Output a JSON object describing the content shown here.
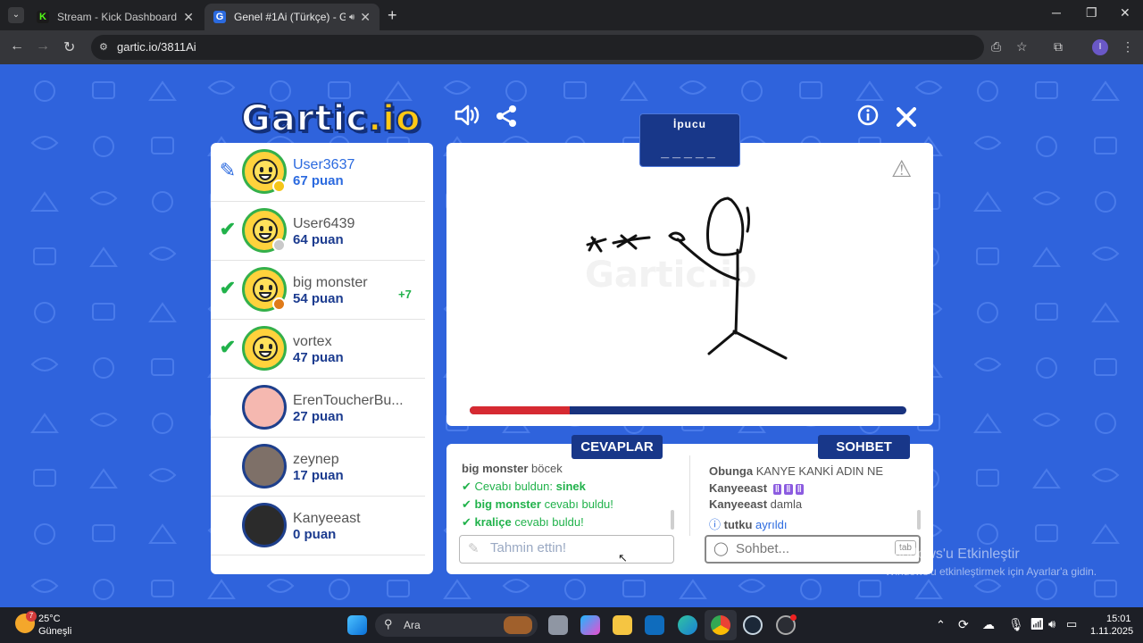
{
  "browser": {
    "tabs": [
      {
        "title": "Stream - Kick Dashboard",
        "icon": "kick-icon",
        "active": false
      },
      {
        "title": "Genel #1Ai (Türkçe) - Gartic",
        "icon": "gartic-icon",
        "active": true
      }
    ],
    "url": "gartic.io/3811Ai",
    "profile_initial": "I"
  },
  "game": {
    "logo_main": "Gartic",
    "logo_suffix": ".io",
    "hint_label": "İpucu",
    "hint_word": "_____",
    "timer_elapsed_fraction": 0.23,
    "players": [
      {
        "name": "User3637",
        "points": "67 puan",
        "status": "drawing",
        "badge_color": "#f5c518",
        "avatar": "smiley",
        "me": true,
        "bonus": ""
      },
      {
        "name": "User6439",
        "points": "64 puan",
        "status": "guessed",
        "badge_color": "#c9c9c9",
        "avatar": "smiley",
        "me": false,
        "bonus": ""
      },
      {
        "name": "big monster",
        "points": "54 puan",
        "status": "guessed",
        "badge_color": "#e07b1a",
        "avatar": "smiley",
        "me": false,
        "bonus": "+7"
      },
      {
        "name": "vortex",
        "points": "47 puan",
        "status": "guessed",
        "badge_color": "",
        "avatar": "smiley",
        "me": false,
        "bonus": ""
      },
      {
        "name": "ErenToucherBu...",
        "points": "27 puan",
        "status": "",
        "badge_color": "",
        "avatar": "tan",
        "me": false,
        "bonus": ""
      },
      {
        "name": "zeynep",
        "points": "17 puan",
        "status": "",
        "badge_color": "",
        "avatar": "photo",
        "me": false,
        "bonus": ""
      },
      {
        "name": "Kanyeeast",
        "points": "0 puan",
        "status": "",
        "badge_color": "",
        "avatar": "dark",
        "me": false,
        "bonus": ""
      }
    ],
    "answers_tab": "CEVAPLAR",
    "chat_tab": "SOHBET",
    "answers": {
      "line1_user": "big monster",
      "line1_text": "böcek",
      "line2_text": "Cevabı buldun: ",
      "line2_word": "sinek",
      "line3_user": "big monster",
      "line3_text": "cevabı buldu!",
      "line4_user": "kraliçe",
      "line4_text": "cevabı buldu!"
    },
    "chat": {
      "line1_user": "Obunga",
      "line1_text": "KANYE KANKİ ADIN NE",
      "line2_user": "Kanyeeast",
      "line2_emotes": [
        "Ⅱ",
        "Ⅱ",
        "Ⅱ"
      ],
      "line3_user": "Kanyeeast",
      "line3_text": "damla",
      "line4_user": "tutku",
      "line4_text": "ayrıldı"
    },
    "guess_placeholder": "Tahmin ettin!",
    "chat_placeholder": "Sohbet...",
    "tab_key": "tab"
  },
  "watermark": {
    "title": "Windows'u Etkinleştir",
    "subtitle": "Windows'u etkinleştirmek için Ayarlar'a gidin."
  },
  "taskbar": {
    "weather_temp": "25°C",
    "weather_desc": "Güneşli",
    "weather_badge": "7",
    "search_label": "Ara",
    "time": "15:01",
    "date": "1.11.2025"
  }
}
